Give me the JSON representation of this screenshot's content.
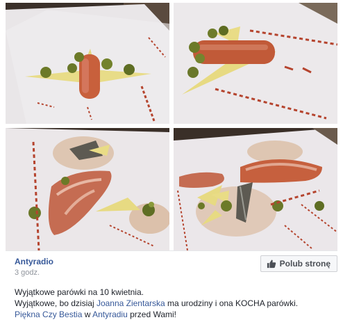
{
  "post": {
    "page_name": "Antyradio",
    "timestamp": "3 godz.",
    "like_button_label": "Polub stronę",
    "like_icon": "thumbs-up-icon",
    "text": {
      "line1": "Wyjątkowe parówki na 10 kwietnia.",
      "line2_a": "Wyjątkowe, bo dzisiaj ",
      "line2_link": "Joanna Zientarska",
      "line2_b": " ma urodziny i ona KOCHA parówki.",
      "line3_link1": "Piękna Czy Bestia",
      "line3_a": " w ",
      "line3_link2": "Antyradiu",
      "line3_b": " przed Wami!"
    }
  },
  "colors": {
    "link": "#365899",
    "text": "#1d2129",
    "meta": "#90949c",
    "button_bg": "#f6f7f9",
    "button_border": "#ced0d4"
  }
}
